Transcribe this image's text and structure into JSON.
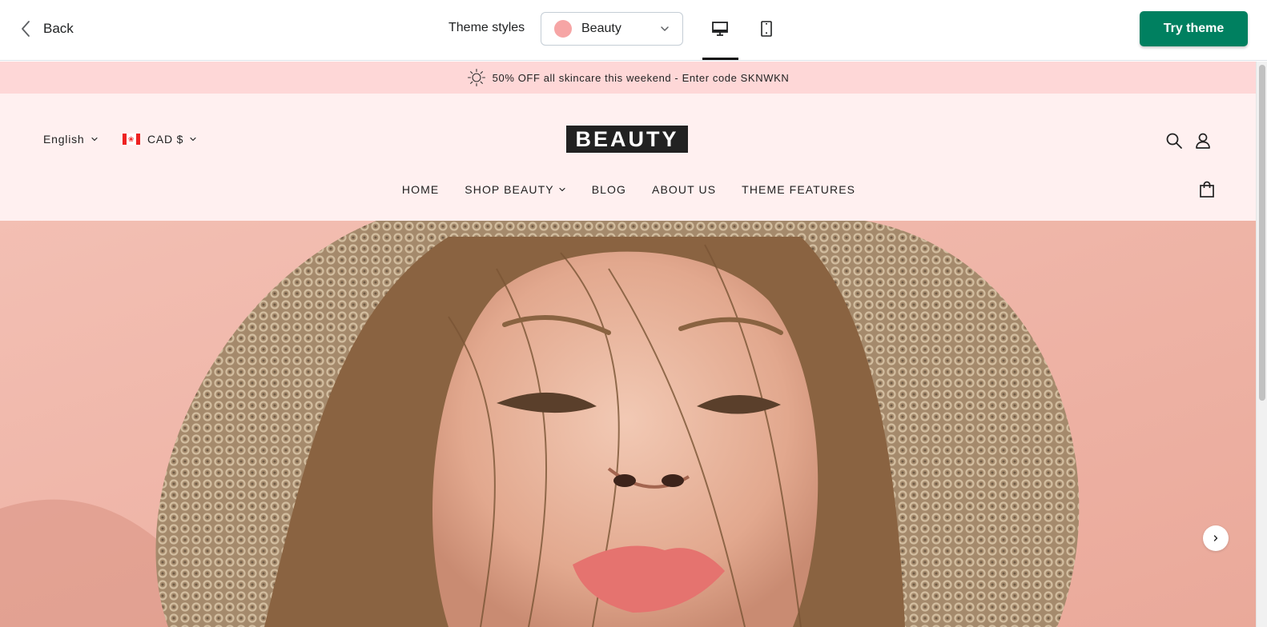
{
  "toolbar": {
    "back_label": "Back",
    "theme_styles_label": "Theme styles",
    "theme_style_value": "Beauty",
    "swatch_color": "#f6a5a5",
    "try_label": "Try theme",
    "try_color": "#008060",
    "devices": [
      "desktop-icon",
      "mobile-icon"
    ],
    "active_device": "desktop"
  },
  "announcement": {
    "text": "50% OFF all skincare this weekend - Enter code SKNWKN",
    "icon": "sun-icon",
    "background": "#fed7d7"
  },
  "store": {
    "language": "English",
    "currency": "CAD $",
    "logo": "BEAUTY",
    "background": "#fff0f0",
    "nav": [
      {
        "label": "HOME"
      },
      {
        "label": "SHOP BEAUTY",
        "has_dropdown": true
      },
      {
        "label": "BLOG"
      },
      {
        "label": "ABOUT US"
      },
      {
        "label": "THEME FEATURES"
      }
    ],
    "header_icons": [
      "search-icon",
      "account-icon",
      "cart-icon"
    ]
  },
  "hero": {
    "background": "#f0b4a8",
    "next_icon": "chevron-right-icon"
  }
}
